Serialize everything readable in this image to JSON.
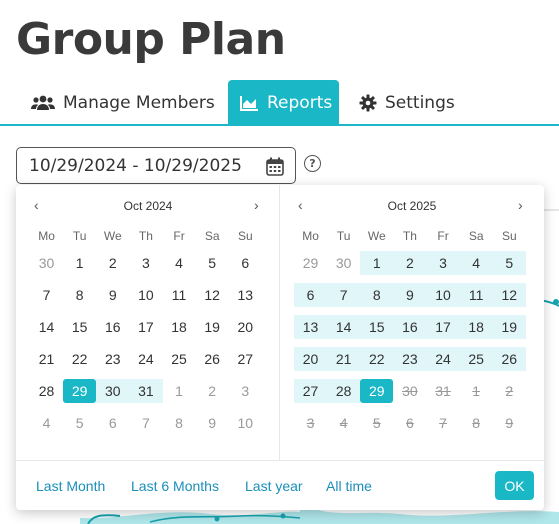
{
  "page": {
    "title": "Group Plan"
  },
  "tabs": [
    {
      "label": "Manage Members",
      "icon": "users-icon"
    },
    {
      "label": "Reports",
      "icon": "chart-area-icon",
      "active": true
    },
    {
      "label": "Settings",
      "icon": "gear-icon"
    }
  ],
  "date_range": {
    "value": "10/29/2024 - 10/29/2025",
    "help": "?"
  },
  "picker": {
    "weekdays": [
      "Mo",
      "Tu",
      "We",
      "Th",
      "Fr",
      "Sa",
      "Su"
    ],
    "left": {
      "month_label": "Oct 2024",
      "weeks": [
        [
          {
            "d": "30",
            "s": "other"
          },
          {
            "d": "1"
          },
          {
            "d": "2"
          },
          {
            "d": "3"
          },
          {
            "d": "4"
          },
          {
            "d": "5"
          },
          {
            "d": "6"
          }
        ],
        [
          {
            "d": "7"
          },
          {
            "d": "8"
          },
          {
            "d": "9"
          },
          {
            "d": "10"
          },
          {
            "d": "11"
          },
          {
            "d": "12"
          },
          {
            "d": "13"
          }
        ],
        [
          {
            "d": "14"
          },
          {
            "d": "15"
          },
          {
            "d": "16"
          },
          {
            "d": "17"
          },
          {
            "d": "18"
          },
          {
            "d": "19"
          },
          {
            "d": "20"
          }
        ],
        [
          {
            "d": "21"
          },
          {
            "d": "22"
          },
          {
            "d": "23"
          },
          {
            "d": "24"
          },
          {
            "d": "25"
          },
          {
            "d": "26"
          },
          {
            "d": "27"
          }
        ],
        [
          {
            "d": "28"
          },
          {
            "d": "29",
            "s": "sel"
          },
          {
            "d": "30",
            "s": "inrange"
          },
          {
            "d": "31",
            "s": "inrange"
          },
          {
            "d": "1",
            "s": "other"
          },
          {
            "d": "2",
            "s": "other"
          },
          {
            "d": "3",
            "s": "other"
          }
        ],
        [
          {
            "d": "4",
            "s": "other"
          },
          {
            "d": "5",
            "s": "other"
          },
          {
            "d": "6",
            "s": "other"
          },
          {
            "d": "7",
            "s": "other"
          },
          {
            "d": "8",
            "s": "other"
          },
          {
            "d": "9",
            "s": "other"
          },
          {
            "d": "10",
            "s": "other"
          }
        ]
      ]
    },
    "right": {
      "month_label": "Oct 2025",
      "weeks": [
        [
          {
            "d": "29",
            "s": "other"
          },
          {
            "d": "30",
            "s": "other"
          },
          {
            "d": "1",
            "s": "inrange"
          },
          {
            "d": "2",
            "s": "inrange"
          },
          {
            "d": "3",
            "s": "inrange"
          },
          {
            "d": "4",
            "s": "inrange"
          },
          {
            "d": "5",
            "s": "inrange"
          }
        ],
        [
          {
            "d": "6",
            "s": "inrange"
          },
          {
            "d": "7",
            "s": "inrange"
          },
          {
            "d": "8",
            "s": "inrange"
          },
          {
            "d": "9",
            "s": "inrange"
          },
          {
            "d": "10",
            "s": "inrange"
          },
          {
            "d": "11",
            "s": "inrange"
          },
          {
            "d": "12",
            "s": "inrange"
          }
        ],
        [
          {
            "d": "13",
            "s": "inrange"
          },
          {
            "d": "14",
            "s": "inrange"
          },
          {
            "d": "15",
            "s": "inrange"
          },
          {
            "d": "16",
            "s": "inrange"
          },
          {
            "d": "17",
            "s": "inrange"
          },
          {
            "d": "18",
            "s": "inrange"
          },
          {
            "d": "19",
            "s": "inrange"
          }
        ],
        [
          {
            "d": "20",
            "s": "inrange"
          },
          {
            "d": "21",
            "s": "inrange"
          },
          {
            "d": "22",
            "s": "inrange"
          },
          {
            "d": "23",
            "s": "inrange"
          },
          {
            "d": "24",
            "s": "inrange"
          },
          {
            "d": "25",
            "s": "inrange"
          },
          {
            "d": "26",
            "s": "inrange"
          }
        ],
        [
          {
            "d": "27",
            "s": "inrange"
          },
          {
            "d": "28",
            "s": "inrange"
          },
          {
            "d": "29",
            "s": "sel"
          },
          {
            "d": "30",
            "s": "dis"
          },
          {
            "d": "31",
            "s": "dis"
          },
          {
            "d": "1",
            "s": "dis"
          },
          {
            "d": "2",
            "s": "dis"
          }
        ],
        [
          {
            "d": "3",
            "s": "dis"
          },
          {
            "d": "4",
            "s": "dis"
          },
          {
            "d": "5",
            "s": "dis"
          },
          {
            "d": "6",
            "s": "dis"
          },
          {
            "d": "7",
            "s": "dis"
          },
          {
            "d": "8",
            "s": "dis"
          },
          {
            "d": "9",
            "s": "dis"
          }
        ]
      ]
    },
    "presets": [
      "Last Month",
      "Last 6 Months",
      "Last year",
      "All time"
    ],
    "ok_label": "OK"
  },
  "colors": {
    "accent": "#1ab8c6",
    "range": "#e0f6f8",
    "link": "#1a8fb8"
  }
}
